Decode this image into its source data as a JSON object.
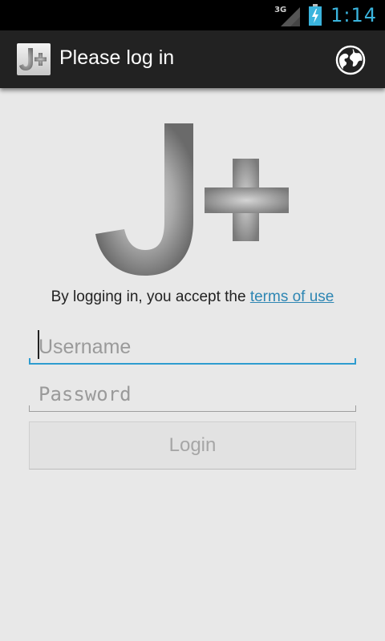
{
  "status_bar": {
    "network_type": "3G",
    "time": "1:14"
  },
  "action_bar": {
    "app_icon_label": "J+",
    "title": "Please log in",
    "language_icon": "globe-icon"
  },
  "logo": {
    "text": "J+"
  },
  "terms": {
    "prefix": "By logging in, you accept the ",
    "link_label": "terms of use"
  },
  "form": {
    "username_placeholder": "Username",
    "password_placeholder": "Password",
    "login_label": "Login"
  },
  "colors": {
    "clock": "#3ab4dd",
    "action_bar": "#222222",
    "link": "#2e86b3",
    "focus_underline": "#2e9ccf"
  }
}
